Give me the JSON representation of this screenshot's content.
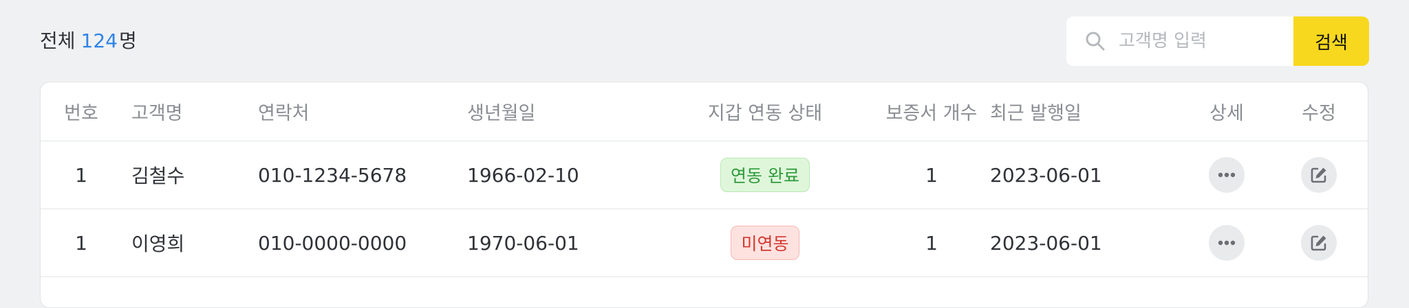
{
  "summary": {
    "label_prefix": "전체",
    "count": "124",
    "label_suffix": "명"
  },
  "search": {
    "placeholder": "고객명 입력",
    "button_label": "검색"
  },
  "table": {
    "columns": [
      "번호",
      "고객명",
      "연락처",
      "생년월일",
      "지갑 연동 상태",
      "보증서 개수",
      "최근 발행일",
      "상세",
      "수정"
    ],
    "rows": [
      {
        "no": "1",
        "name": "김철수",
        "phone": "010-1234-5678",
        "birth": "1966-02-10",
        "wallet_status": "연동 완료",
        "warranty_count": "1",
        "last_issued": "2023-06-01"
      },
      {
        "no": "1",
        "name": "이영희",
        "phone": "010-0000-0000",
        "birth": "1970-06-01",
        "wallet_status": "미연동",
        "warranty_count": "1",
        "last_issued": "2023-06-01"
      }
    ]
  },
  "icons": {
    "search": "search-icon",
    "detail": "more-dots-icon",
    "edit": "edit-icon"
  },
  "colors": {
    "accent_count": "#2f84e6",
    "search_button": "#f7d81f",
    "status_linked": "#2f9a3b",
    "status_unlinked": "#d3382f"
  }
}
